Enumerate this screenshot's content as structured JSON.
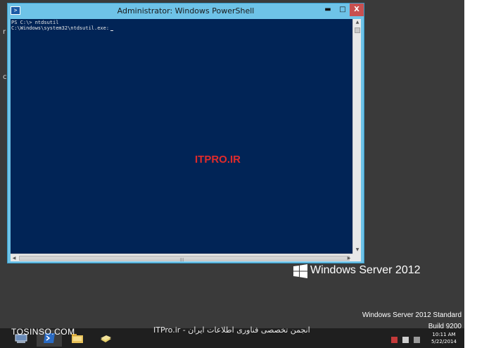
{
  "window": {
    "title": "Administrator: Windows PowerShell",
    "controls": {
      "minimize": "▬",
      "maximize": "□",
      "close": "X"
    }
  },
  "console": {
    "lines": [
      "PS C:\\> ntdsutil",
      "C:\\Windows\\system32\\ntdsutil.exe:"
    ]
  },
  "watermark_center": "ITPRO.IR",
  "desktop_fragments": [
    "r",
    "c"
  ],
  "branding": {
    "logo_text": "Windows Server 2012",
    "edition": "Windows Server 2012 Standard",
    "build": "Build 9200"
  },
  "taskbar": {
    "clock_time": "10:11 AM",
    "clock_date": "5/22/2014"
  },
  "watermarks": {
    "left": "TOSINSO.COM",
    "bottom": "ITPro.ir - انجمن تخصصی فناوری اطلاعات ایران"
  },
  "colors": {
    "console_bg": "#012456",
    "window_frame": "#6ec3e8",
    "desktop": "#3a3a3a",
    "watermark": "#e12b2b"
  },
  "icons": {
    "window": "powershell-icon",
    "taskbar": [
      "server-manager-icon",
      "powershell-icon",
      "file-explorer-icon",
      "notepad-icon"
    ],
    "tray": [
      "network-icon",
      "flag-icon",
      "volume-icon"
    ]
  }
}
